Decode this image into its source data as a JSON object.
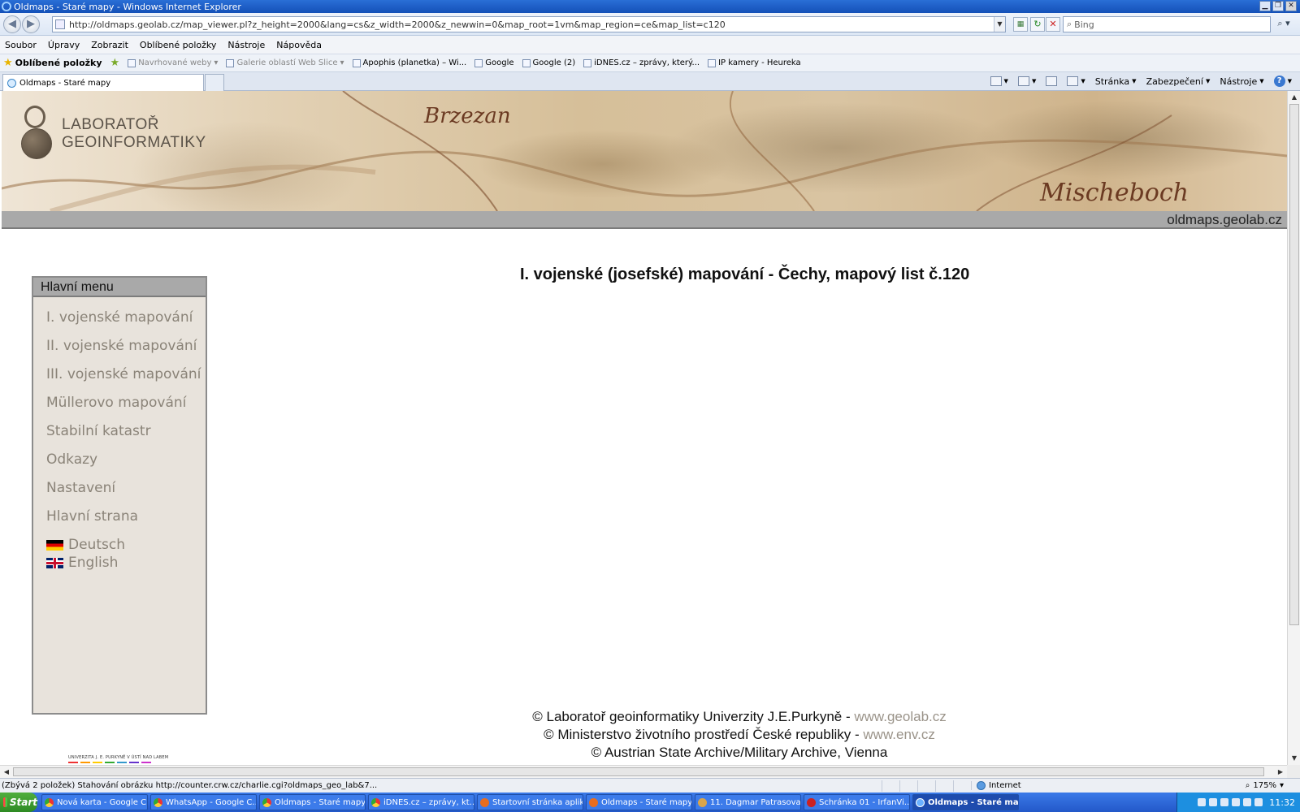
{
  "window": {
    "title": "Oldmaps - Staré mapy - Windows Internet Explorer"
  },
  "addressbar": {
    "url": "http://oldmaps.geolab.cz/map_viewer.pl?z_height=2000&lang=cs&z_width=2000&z_newwin=0&map_root=1vm&map_region=ce&map_list=c120",
    "search_placeholder": "Bing"
  },
  "menubar": {
    "items": [
      "Soubor",
      "Úpravy",
      "Zobrazit",
      "Oblíbené položky",
      "Nástroje",
      "Nápověda"
    ]
  },
  "favorites": {
    "label": "Oblíbené položky",
    "items": [
      {
        "label": "Navrhované weby",
        "dim": true
      },
      {
        "label": "Galerie oblastí Web Slice",
        "dim": true
      },
      {
        "label": "Apophis (planetka) – Wi..."
      },
      {
        "label": "Google"
      },
      {
        "label": "Google (2)"
      },
      {
        "label": "iDNES.cz – zprávy, který..."
      },
      {
        "label": "IP kamery - Heureka"
      }
    ]
  },
  "tabs": [
    {
      "label": "Oldmaps - Staré mapy"
    }
  ],
  "commandbar": {
    "page": "Stránka",
    "security": "Zabezpečení",
    "tools": "Nástroje",
    "help_glyph": "?"
  },
  "banner": {
    "brand_line1": "LABORATOŘ",
    "brand_line2": "GEOINFORMATIKY",
    "place1": "Brzezan",
    "place2": "Mischeboch",
    "site": "oldmaps.geolab.cz"
  },
  "sidebar": {
    "title": "Hlavní menu",
    "items": [
      {
        "label": "I. vojenské mapování"
      },
      {
        "label": "II. vojenské mapování"
      },
      {
        "label": "III. vojenské mapování"
      },
      {
        "label": "Müllerovo mapování"
      },
      {
        "label": "Stabilní katastr"
      },
      {
        "label": "Odkazy"
      },
      {
        "label": "Nastavení"
      },
      {
        "label": "Hlavní strana"
      }
    ],
    "languages": [
      {
        "label": "Deutsch"
      },
      {
        "label": "English"
      }
    ]
  },
  "main": {
    "heading": "I. vojenské (josefské) mapování - Čechy, mapový list č.120"
  },
  "university_logo_text": "UNIVERZITA J. E. PURKYNĚ V ÚSTÍ NAD LABEM",
  "footer": {
    "line1_text": "© Laboratoř geoinformatiky Univerzity J.E.Purkyně - ",
    "line1_link": "www.geolab.cz",
    "line2_text": "© Ministerstvo životního prostředí České republiky - ",
    "line2_link": "www.env.cz",
    "line3_text": "© Austrian State Archive/Military Archive, Vienna"
  },
  "statusbar": {
    "message": "(Zbývá 2 položek) Stahování obrázku http://counter.crw.cz/charlie.cgi?oldmaps_geo_lab&7...",
    "zone": "Internet",
    "zoom": "175%"
  },
  "taskbar": {
    "start": "Start",
    "tasks": [
      {
        "label": "Nová karta - Google C...",
        "icon": "chrome"
      },
      {
        "label": "WhatsApp - Google C...",
        "icon": "wa"
      },
      {
        "label": "Oldmaps - Staré mapy...",
        "icon": "chrome"
      },
      {
        "label": "iDNES.cz – zprávy, kt...",
        "icon": "chrome"
      },
      {
        "label": "Startovní stránka aplik...",
        "icon": "ff"
      },
      {
        "label": "Oldmaps - Staré mapy...",
        "icon": "ff"
      },
      {
        "label": "11. Dagmar Patrasova...",
        "icon": "note"
      },
      {
        "label": "Schránka 01 - IrfanVi...",
        "icon": "irf"
      },
      {
        "label": "Oldmaps - Staré ma...",
        "icon": "ie",
        "active": true
      }
    ],
    "clock": "11:32"
  },
  "colors": {
    "menu_link": "#8a8378",
    "footer_link": "#9a9389",
    "banner_bar": "#a9a9a9"
  }
}
